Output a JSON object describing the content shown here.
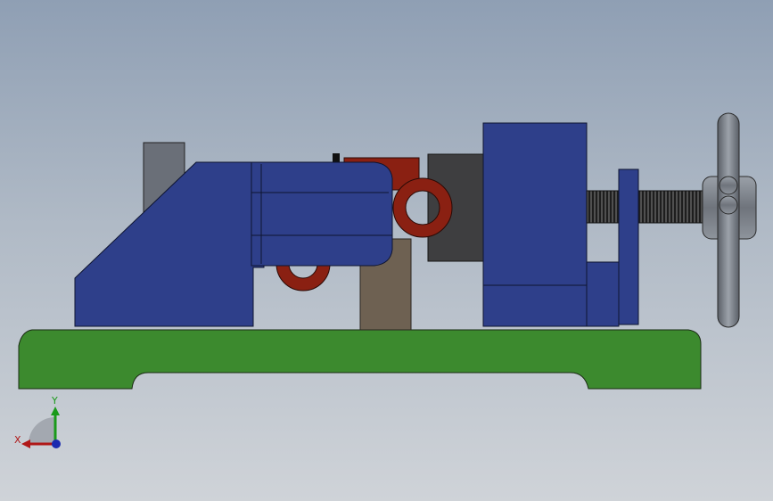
{
  "viewport": {
    "background_top": "#8f9fb4",
    "background_bottom": "#cfd3d8"
  },
  "model": {
    "parts": [
      {
        "name": "base-plate",
        "color": "#3c8a2e"
      },
      {
        "name": "fixed-jaw-body",
        "color": "#2e3f8a"
      },
      {
        "name": "grey-stop-block",
        "color": "#6a6f78"
      },
      {
        "name": "clamp-arm",
        "color": "#2e3f8a"
      },
      {
        "name": "red-link",
        "color": "#8a2012"
      },
      {
        "name": "post",
        "color": "#6e6152"
      },
      {
        "name": "dark-jaw-plate",
        "color": "#3e3e40"
      },
      {
        "name": "moving-jaw-body",
        "color": "#2e3f8a"
      },
      {
        "name": "end-plate",
        "color": "#2e3f8a"
      },
      {
        "name": "lead-screw",
        "color": "#3a3a3a"
      },
      {
        "name": "handwheel-hub",
        "color": "#7a7f88"
      },
      {
        "name": "handle-bar",
        "color": "#7a7f88"
      }
    ]
  },
  "triad": {
    "x_label": "X",
    "y_label": "Y",
    "x_color": "#b01818",
    "y_color": "#1a9a1a",
    "z_color": "#1a2ab0"
  }
}
